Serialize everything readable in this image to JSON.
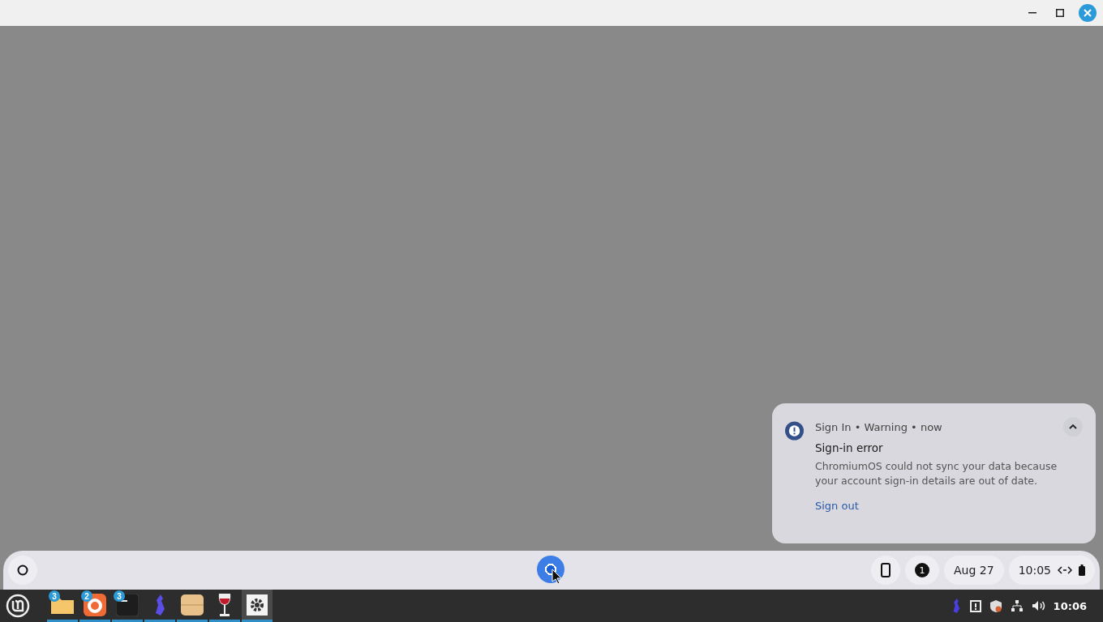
{
  "notification": {
    "app": "Sign In",
    "separator": "•",
    "severity": "Warning",
    "time": "now",
    "title": "Sign-in error",
    "body": "ChromiumOS could not sync your data because your account sign-in details are out of date.",
    "action": "Sign out",
    "expanded": true
  },
  "shelf": {
    "notification_count": "1",
    "date": "Aug 27",
    "time": "10:05"
  },
  "taskbar": {
    "apps": [
      {
        "kind": "folder",
        "badge": "3",
        "running": true,
        "selected": false
      },
      {
        "kind": "ring",
        "badge": "2",
        "running": true,
        "selected": false
      },
      {
        "kind": "terminal",
        "badge": "3",
        "running": true,
        "selected": false
      },
      {
        "kind": "figure",
        "running": true,
        "selected": false
      },
      {
        "kind": "box",
        "running": true,
        "selected": false
      },
      {
        "kind": "wine",
        "running": true,
        "selected": false
      },
      {
        "kind": "gear",
        "running": true,
        "selected": true
      }
    ],
    "clock": "10:06"
  }
}
